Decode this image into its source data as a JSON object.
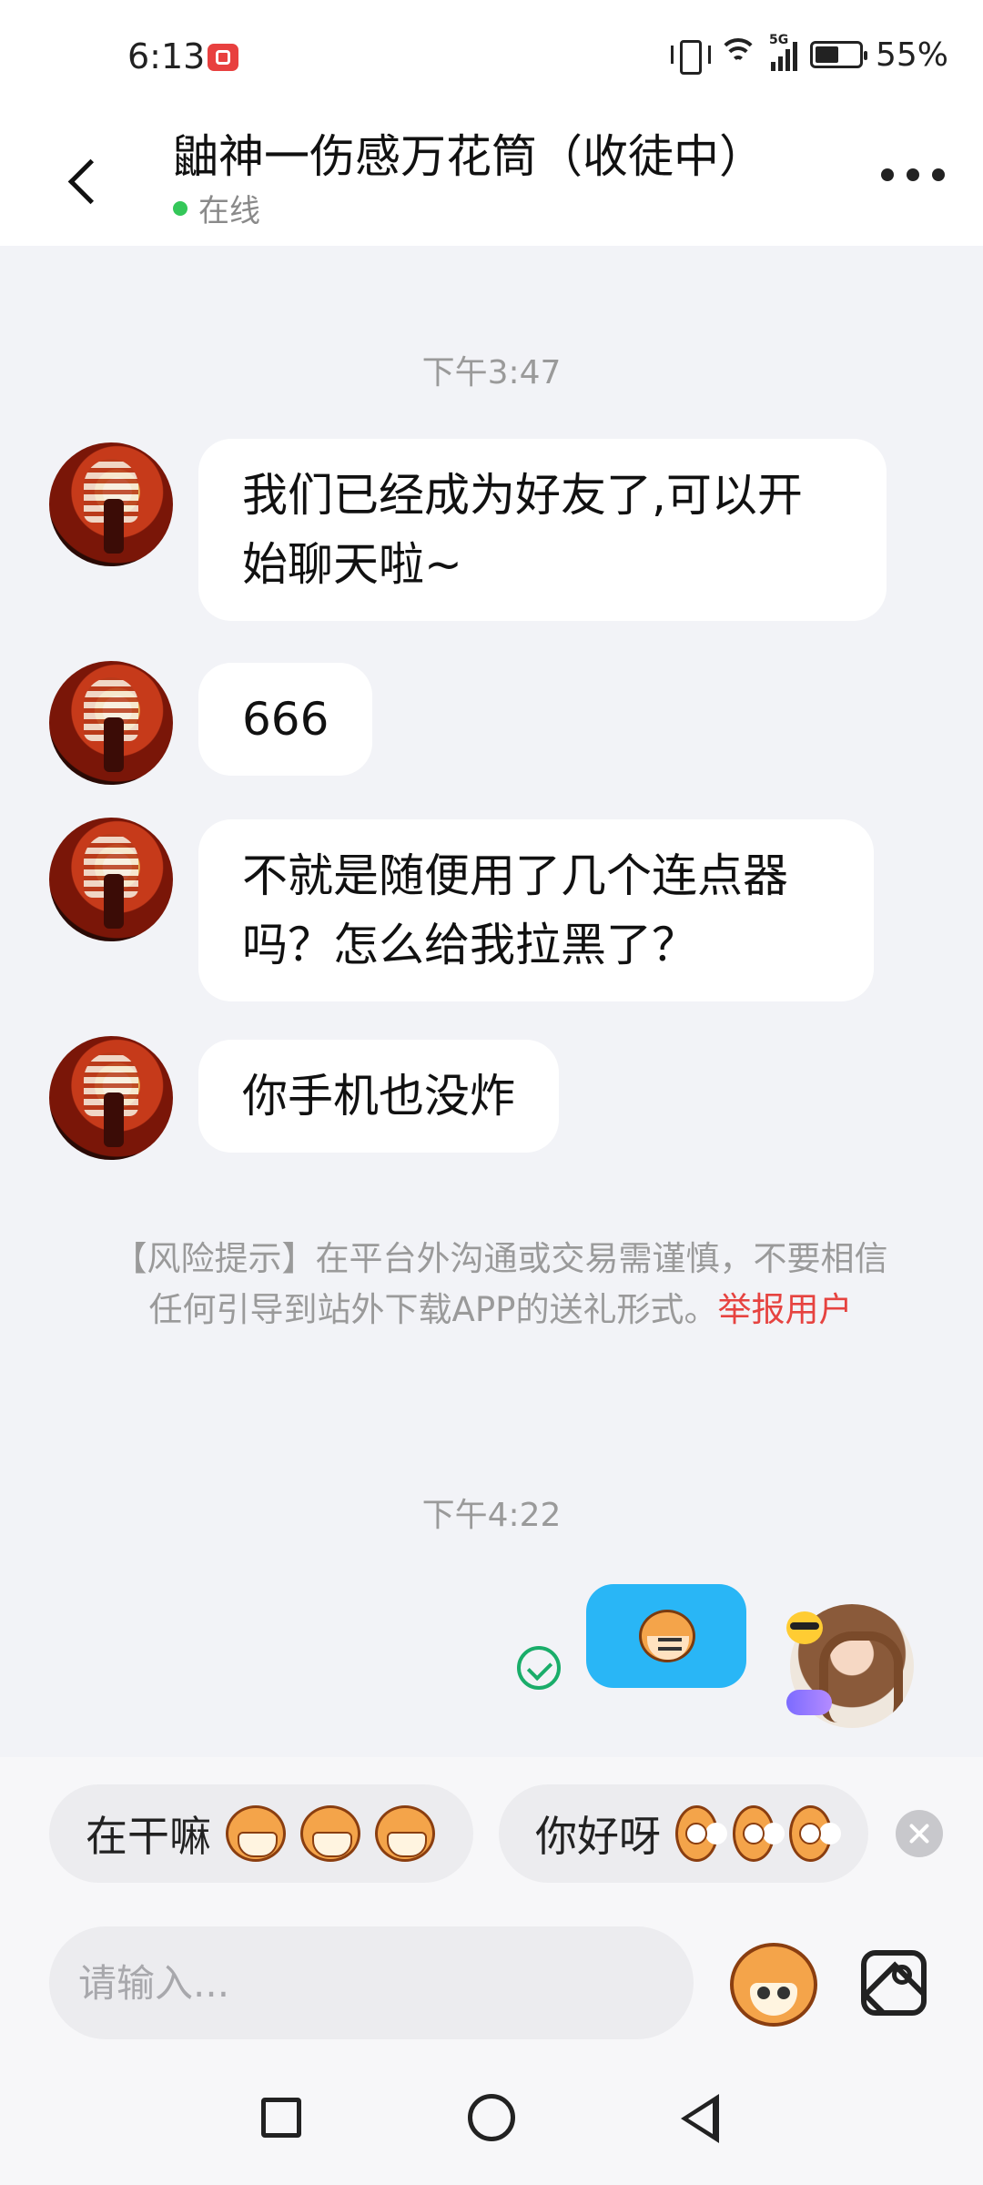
{
  "status_bar": {
    "time": "6:13",
    "network": "5G",
    "battery_percent": "55%",
    "battery_level": 0.55
  },
  "header": {
    "title": "鼬神一伤感万花筒（收徒中）",
    "status": "在线"
  },
  "chat": {
    "time_labels": [
      "下午3:47",
      "下午4:22"
    ],
    "incoming_messages": [
      {
        "line1": "我们已经成为好友了,可以开",
        "line2": "始聊天啦~"
      },
      {
        "line1": "666"
      },
      {
        "line1": "不就是随便用了几个连点器",
        "line2": "吗？怎么给我拉黑了？"
      },
      {
        "line1": "你手机也没炸"
      }
    ],
    "risk_notice": {
      "text": "【风险提示】在平台外沟通或交易需谨慎，不要相信任何引导到站外下载APP的送礼形式。",
      "link": "举报用户"
    },
    "outgoing": {
      "type": "sticker",
      "sticker_icon": "monkey-sticker-icon",
      "status_icon": "sent-check-icon"
    }
  },
  "quick_replies": [
    {
      "label": "在干嘛"
    },
    {
      "label": "你好呀"
    }
  ],
  "input": {
    "placeholder": "请输入..."
  },
  "colors": {
    "chat_bg": "#f2f3f7",
    "my_bubble": "#29b6f6",
    "online": "#34c759",
    "link_red": "#e64340",
    "check_green": "#1aad6a"
  }
}
